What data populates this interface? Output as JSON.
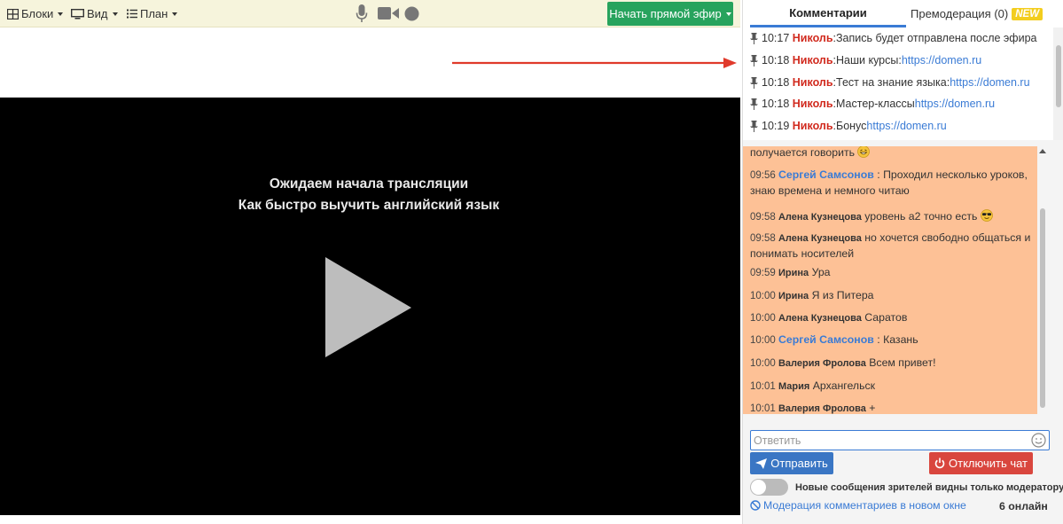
{
  "toolbar": {
    "blocks_label": "Блоки",
    "view_label": "Вид",
    "plan_label": "План",
    "live_button_label": "Начать прямой эфир",
    "icons": [
      "blocks-grid-icon",
      "monitor-icon",
      "list-icon",
      "microphone-icon",
      "camera-icon",
      "record-icon"
    ]
  },
  "video": {
    "title_line1": "Ожидаем начала трансляции",
    "title_line2": "Как быстро выучить английский язык",
    "play_icon": "play-icon"
  },
  "tabs": {
    "comments": "Комментарии",
    "premoderation": "Премодерация (0)",
    "new_badge": "NEW"
  },
  "pinned": [
    {
      "time": "10:17",
      "author": "Николь",
      "text": ":Запись будет отправлена после эфира",
      "link": ""
    },
    {
      "time": "10:18",
      "author": "Николь",
      "text": ":Наши курсы: ",
      "link": "https://domen.ru"
    },
    {
      "time": "10:18",
      "author": "Николь",
      "text": ":Тест на знание языка: ",
      "link": "https://domen.ru"
    },
    {
      "time": "10:18",
      "author": "Николь",
      "text": ":Мастер-классы ",
      "link": "https://domen.ru"
    },
    {
      "time": "10:19",
      "author": "Николь",
      "text": ":Бонус ",
      "link": "https://domen.ru"
    }
  ],
  "chat": {
    "partial_text": "получается говорить",
    "messages": [
      {
        "time": "09:56",
        "author": "Сергей Самсонов",
        "sep": " : ",
        "text": "Проходил несколько уроков, знаю времена и немного читаю",
        "style": "blue"
      },
      {
        "time": "09:58",
        "author": "Алена Кузнецова",
        "sep": " ",
        "text": "уровень а2 точно есть",
        "style": "dark"
      },
      {
        "time": "09:58",
        "author": "Алена Кузнецова",
        "sep": " ",
        "text": "но хочется свободно общаться и понимать носителей",
        "style": "dark"
      },
      {
        "time": "09:59",
        "author": "Ирина",
        "sep": " ",
        "text": "Ура",
        "style": "dark"
      },
      {
        "time": "10:00",
        "author": "Ирина",
        "sep": " ",
        "text": "Я из Питера",
        "style": "dark"
      },
      {
        "time": "10:00",
        "author": "Алена Кузнецова",
        "sep": " ",
        "text": "Саратов",
        "style": "dark"
      },
      {
        "time": "10:00",
        "author": "Сергей Самсонов",
        "sep": " : ",
        "text": "Казань",
        "style": "blue"
      },
      {
        "time": "10:00",
        "author": "Валерия Фролова",
        "sep": " ",
        "text": "Всем привет!",
        "style": "dark"
      },
      {
        "time": "10:01",
        "author": "Мария",
        "sep": " ",
        "text": "Архангельск",
        "style": "dark"
      },
      {
        "time": "10:01",
        "author": "Валерия Фролова",
        "sep": " ",
        "text": "+",
        "style": "dark"
      }
    ]
  },
  "reply": {
    "placeholder": "Ответить"
  },
  "buttons": {
    "send": "Отправить",
    "disable_chat": "Отключить чат"
  },
  "toggle": {
    "label": "Новые сообщения зрителей видны только модератору",
    "state": "off"
  },
  "footer": {
    "moderation_link": "Модерация комментариев в новом окне",
    "online": "6 онлайн"
  },
  "colors": {
    "accent_blue": "#3a7bd5",
    "author_red": "#d12a1e",
    "chat_bg": "#fdc196",
    "live_green": "#27a35d",
    "danger_red": "#d9463e",
    "toolbar_bg": "#f6f4dc"
  }
}
